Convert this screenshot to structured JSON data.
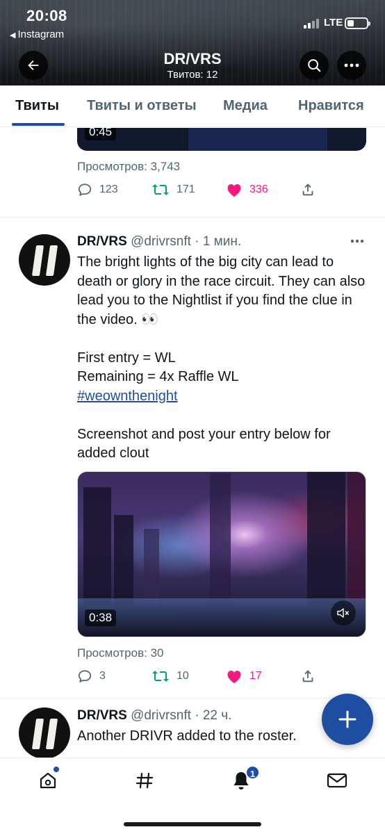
{
  "status_bar": {
    "time": "20:08",
    "back_app": "Instagram",
    "network": "LTE"
  },
  "header": {
    "title": "DR/VRS",
    "tweet_count": "Твитов: 12",
    "back_icon": "arrow-left-icon",
    "search_icon": "search-icon",
    "more_icon": "more-horizontal-icon"
  },
  "tabs": [
    {
      "label": "Твиты",
      "active": true
    },
    {
      "label": "Твиты и ответы",
      "active": false
    },
    {
      "label": "Медиа",
      "active": false
    },
    {
      "label": "Нравится",
      "active": false
    }
  ],
  "accent_color": "#1d4ea1",
  "like_color": "#f91880",
  "tweets": [
    {
      "video_duration": "0:45",
      "views": "Просмотров: 3,743",
      "replies": "123",
      "retweets": "171",
      "likes": "336"
    },
    {
      "display_name": "DR/VRS",
      "handle": "@drivrsnft",
      "time": "1 мин.",
      "text_lines": [
        "The bright lights of the big city can lead to death or glory in the race circuit. They can also lead you to the Nightlist if you find the clue in the video. 👀",
        "First entry = WL",
        "Remaining = 4x Raffle WL",
        "#weownthenight",
        "Screenshot and post your entry below for added clout"
      ],
      "video_duration": "0:38",
      "views": "Просмотров: 30",
      "replies": "3",
      "retweets": "10",
      "likes": "17"
    },
    {
      "display_name": "DR/VRS",
      "handle": "@drivrsnft",
      "time": "22 ч.",
      "text": "Another DRIVR added to the roster."
    }
  ],
  "bottom_nav": {
    "items": [
      "home-icon",
      "hashtag-icon",
      "bell-icon",
      "mail-icon"
    ],
    "notifications_badge": "1"
  }
}
